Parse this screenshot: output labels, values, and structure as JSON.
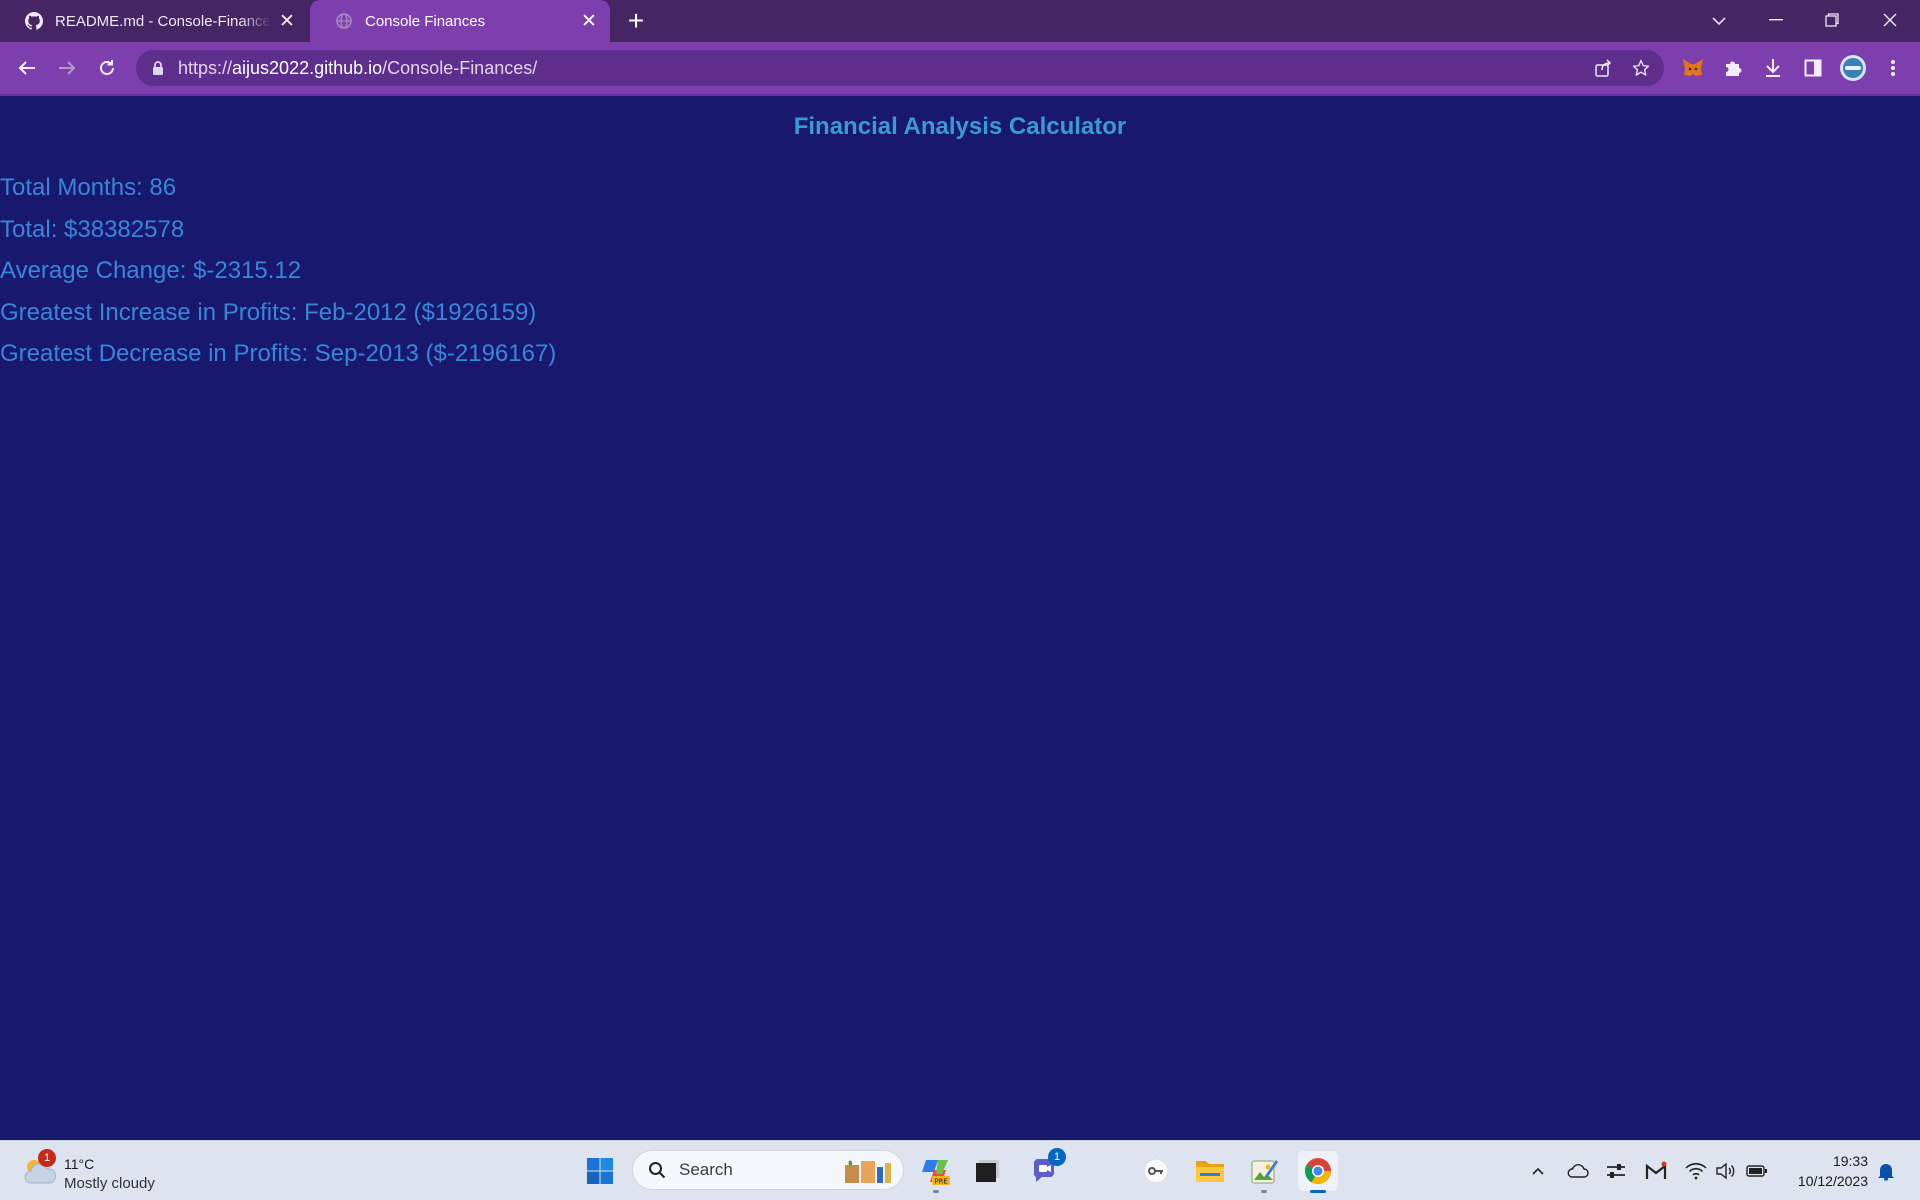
{
  "browser": {
    "tabs": [
      {
        "title": "README.md - Console-Finances",
        "favicon": "github-icon",
        "active": false
      },
      {
        "title": "Console Finances",
        "favicon": "globe-icon",
        "active": true
      }
    ],
    "address": {
      "protocol": "https://",
      "host": "aijus2022.github.io",
      "path": "/Console-Finances/"
    },
    "toolbar_icons": [
      "back-icon",
      "forward-icon",
      "reload-icon",
      "share-icon",
      "bookmark-star-icon",
      "metamask-extension-icon",
      "extensions-puzzle-icon",
      "download-icon",
      "side-panel-icon",
      "profile-avatar",
      "menu-kebab-icon"
    ],
    "colors": {
      "tabstrip": "#452563",
      "toolbar": "#7c3fad",
      "omnibox": "#5d2e8c"
    }
  },
  "page": {
    "title": "Financial Analysis Calculator",
    "stats": [
      "Total Months: 86",
      "Total: $38382578",
      "Average Change: $-2315.12",
      "Greatest Increase in Profits: Feb-2012 ($1926159)",
      "Greatest Decrease in Profits: Sep-2013 ($-2196167)"
    ],
    "colors": {
      "background": "#18186f",
      "title": "#3a9ad6",
      "text": "#3a86d6"
    }
  },
  "taskbar": {
    "weather": {
      "temp": "11°C",
      "condition": "Mostly cloudy",
      "badge": "1"
    },
    "search_placeholder": "Search",
    "teams_badge": "1",
    "clock": {
      "time": "19:33",
      "date": "10/12/2023"
    }
  }
}
